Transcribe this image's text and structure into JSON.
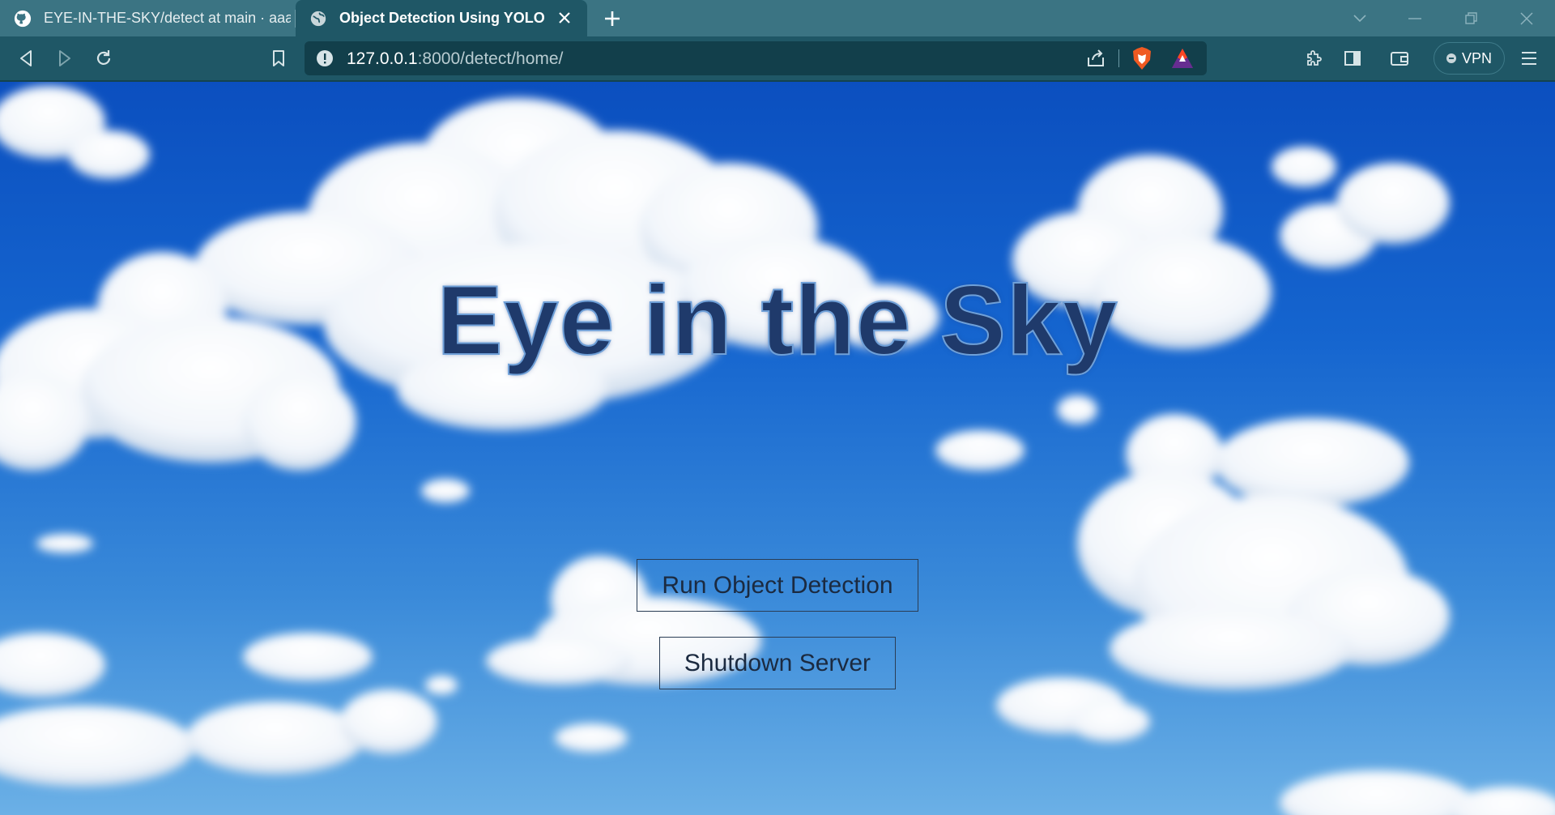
{
  "tabs": [
    {
      "title": "EYE-IN-THE-SKY/detect at main · aaay",
      "icon": "github-icon",
      "active": false
    },
    {
      "title": "Object Detection Using YOLO",
      "icon": "globe-icon",
      "active": true
    }
  ],
  "address_bar": {
    "host": "127.0.0.1",
    "path": ":8000/detect/home/"
  },
  "toolbar": {
    "vpn_label": "VPN"
  },
  "page": {
    "heading": "Eye in the Sky",
    "buttons": {
      "run_detection": "Run Object Detection",
      "shutdown": "Shutdown Server"
    }
  },
  "colors": {
    "tabstrip_bg": "#3b7483",
    "toolbar_bg": "#1f5766",
    "urlbar_bg": "#123f4b",
    "sky_top": "#0b4fbf",
    "sky_bottom": "#6bb0e6",
    "heading_fill": "#1f3a6b",
    "button_border": "#2a3d55"
  }
}
